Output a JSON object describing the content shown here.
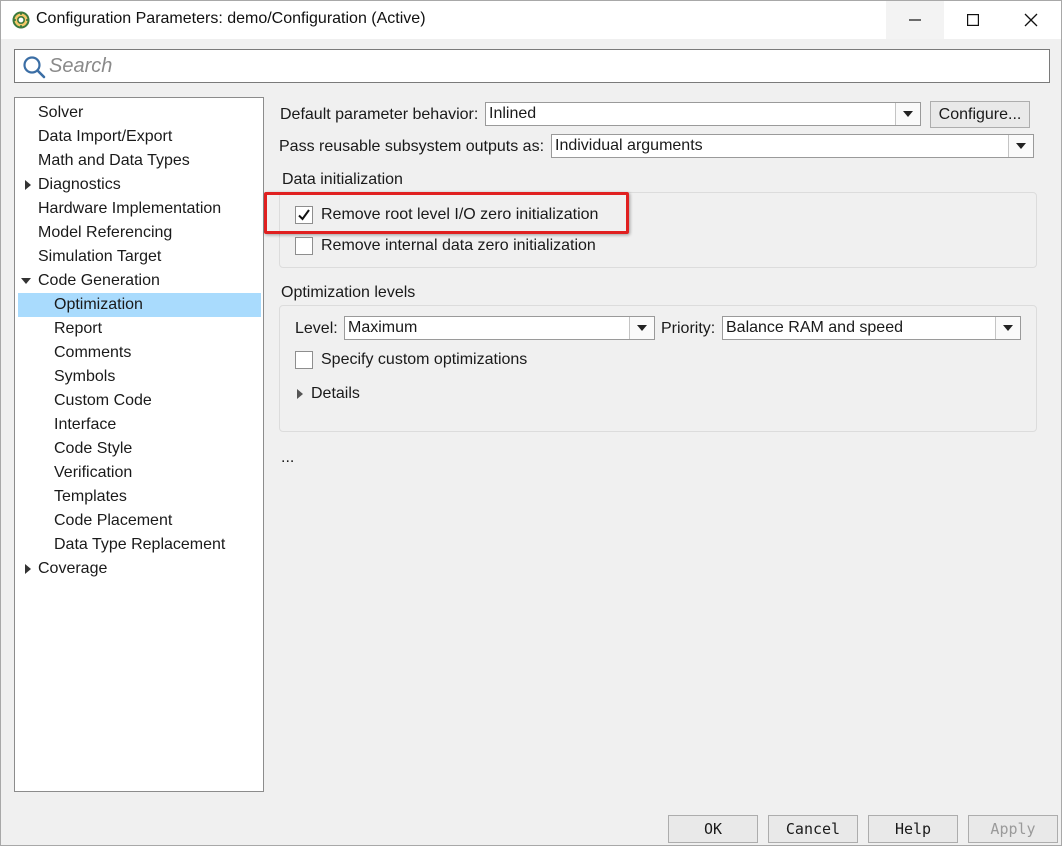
{
  "window": {
    "title": "Configuration Parameters: demo/Configuration (Active)"
  },
  "search": {
    "placeholder": "Search"
  },
  "tree": {
    "items": [
      {
        "label": "Solver",
        "level": 0,
        "arrow": "none"
      },
      {
        "label": "Data Import/Export",
        "level": 0,
        "arrow": "none"
      },
      {
        "label": "Math and Data Types",
        "level": 0,
        "arrow": "none"
      },
      {
        "label": "Diagnostics",
        "level": 0,
        "arrow": "collapsed"
      },
      {
        "label": "Hardware Implementation",
        "level": 0,
        "arrow": "none"
      },
      {
        "label": "Model Referencing",
        "level": 0,
        "arrow": "none"
      },
      {
        "label": "Simulation Target",
        "level": 0,
        "arrow": "none"
      },
      {
        "label": "Code Generation",
        "level": 0,
        "arrow": "expanded"
      },
      {
        "label": "Optimization",
        "level": 1,
        "arrow": "none",
        "selected": true
      },
      {
        "label": "Report",
        "level": 1,
        "arrow": "none"
      },
      {
        "label": "Comments",
        "level": 1,
        "arrow": "none"
      },
      {
        "label": "Symbols",
        "level": 1,
        "arrow": "none"
      },
      {
        "label": "Custom Code",
        "level": 1,
        "arrow": "none"
      },
      {
        "label": "Interface",
        "level": 1,
        "arrow": "none"
      },
      {
        "label": "Code Style",
        "level": 1,
        "arrow": "none"
      },
      {
        "label": "Verification",
        "level": 1,
        "arrow": "none"
      },
      {
        "label": "Templates",
        "level": 1,
        "arrow": "none"
      },
      {
        "label": "Code Placement",
        "level": 1,
        "arrow": "none"
      },
      {
        "label": "Data Type Replacement",
        "level": 1,
        "arrow": "none"
      },
      {
        "label": "Coverage",
        "level": 0,
        "arrow": "collapsed"
      }
    ]
  },
  "main": {
    "default_param_label": "Default parameter behavior:",
    "default_param_value": "Inlined",
    "configure_label": "Configure...",
    "pass_reusable_label": "Pass reusable subsystem outputs as:",
    "pass_reusable_value": "Individual arguments",
    "data_init": {
      "title": "Data initialization",
      "remove_root_label": "Remove root level I/O zero initialization",
      "remove_root_checked": true,
      "remove_internal_label": "Remove internal data zero initialization",
      "remove_internal_checked": false
    },
    "opt_levels": {
      "title": "Optimization levels",
      "level_label": "Level:",
      "level_value": "Maximum",
      "priority_label": "Priority:",
      "priority_value": "Balance RAM and speed",
      "custom_opt_label": "Specify custom optimizations",
      "custom_opt_checked": false,
      "details_label": "Details"
    },
    "ellipsis": "..."
  },
  "buttons": {
    "ok": "OK",
    "cancel": "Cancel",
    "help": "Help",
    "apply": "Apply"
  },
  "colors": {
    "selection": "#a9dbfd",
    "highlight_box": "#e02020"
  }
}
